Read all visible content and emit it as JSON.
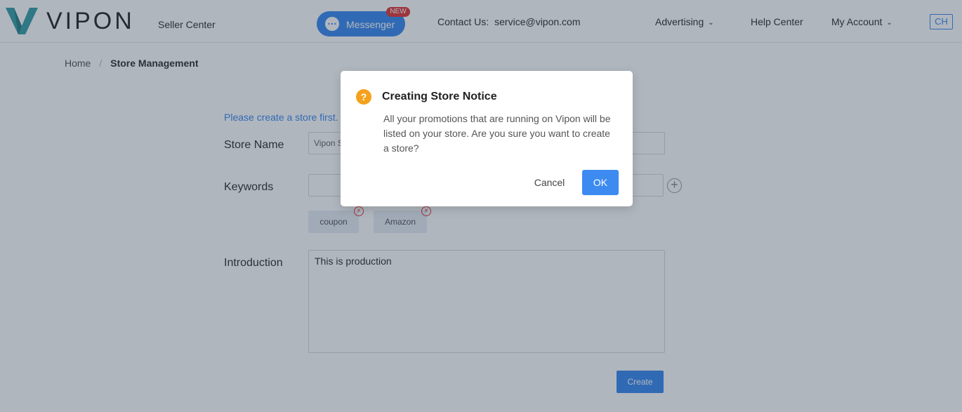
{
  "header": {
    "brand": "VIPON",
    "subtitle": "Seller Center",
    "messenger_label": "Messenger",
    "new_badge": "NEW",
    "contact_label": "Contact Us:",
    "contact_email": "service@vipon.com",
    "nav": {
      "advertising": "Advertising",
      "help_center": "Help Center",
      "my_account": "My Account"
    },
    "language": "CH"
  },
  "breadcrumb": {
    "home": "Home",
    "separator": "/",
    "current": "Store Management"
  },
  "form": {
    "notice": "Please create a store first.",
    "store_name_label": "Store Name",
    "store_name_value": "Vipon S",
    "keywords_label": "Keywords",
    "keywords_value": "",
    "tags": [
      "coupon",
      "Amazon"
    ],
    "introduction_label": "Introduction",
    "introduction_value": "This is production",
    "create_label": "Create"
  },
  "modal": {
    "title": "Creating Store Notice",
    "body": "All your promotions that are running on Vipon will be listed on your store. Are you sure you want to create a store?",
    "cancel_label": "Cancel",
    "ok_label": "OK"
  },
  "colors": {
    "primary": "#3d8bf0",
    "warning": "#f5a11c",
    "danger": "#e23a3a",
    "logo": "#3aa0a8"
  }
}
